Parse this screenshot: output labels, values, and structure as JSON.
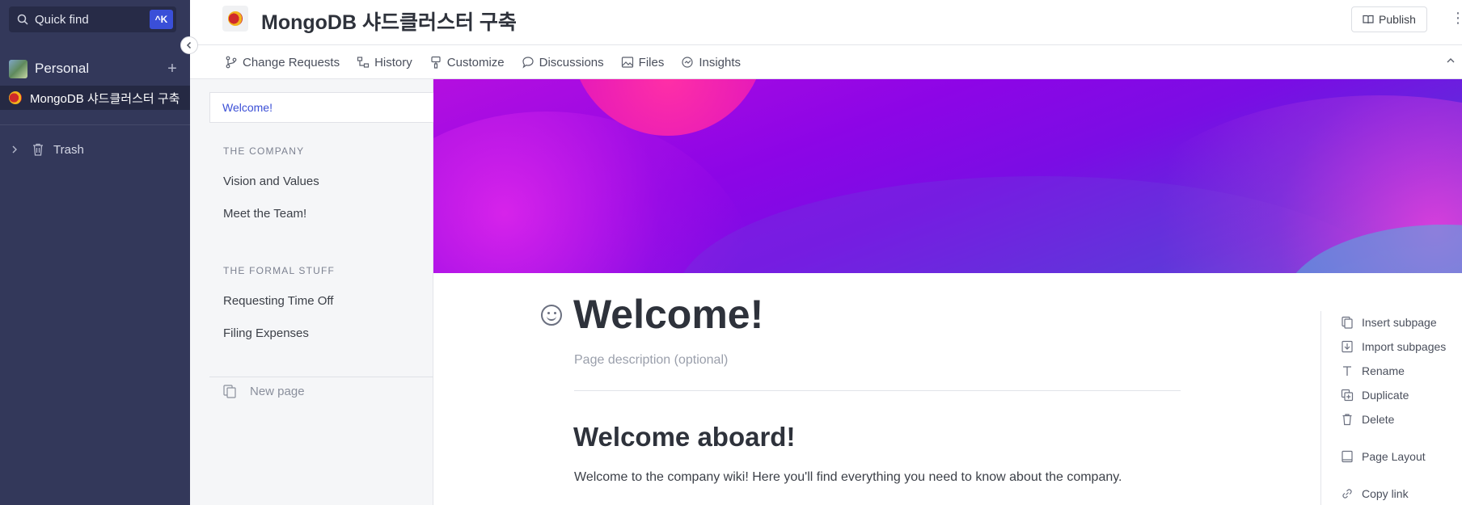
{
  "sidebar": {
    "quick_find": "Quick find",
    "shortcut": "^K",
    "space_name": "Personal",
    "active_page": "MongoDB 샤드클러스터 구축",
    "trash": "Trash"
  },
  "header": {
    "title": "MongoDB 샤드클러스터 구축",
    "publish": "Publish"
  },
  "tabs": [
    {
      "label": "Change Requests",
      "icon": "branch-icon"
    },
    {
      "label": "History",
      "icon": "history-icon"
    },
    {
      "label": "Customize",
      "icon": "paint-icon"
    },
    {
      "label": "Discussions",
      "icon": "chat-icon"
    },
    {
      "label": "Files",
      "icon": "image-icon"
    },
    {
      "label": "Insights",
      "icon": "insights-icon"
    }
  ],
  "tree": {
    "active": "Welcome!",
    "sections": [
      {
        "heading": "THE COMPANY",
        "items": [
          "Vision and Values",
          "Meet the Team!"
        ]
      },
      {
        "heading": "THE FORMAL STUFF",
        "items": [
          "Requesting Time Off",
          "Filing Expenses"
        ]
      }
    ],
    "new_page": "New page"
  },
  "document": {
    "title": "Welcome!",
    "description_placeholder": "Page description (optional)",
    "heading": "Welcome aboard!",
    "paragraph": "Welcome to the company wiki! Here you'll find everything you need to know about the company."
  },
  "actions": [
    {
      "label": "Insert subpage",
      "icon": "insert-subpage-icon"
    },
    {
      "label": "Import subpages",
      "icon": "import-icon"
    },
    {
      "label": "Rename",
      "icon": "text-icon"
    },
    {
      "label": "Duplicate",
      "icon": "duplicate-icon"
    },
    {
      "label": "Delete",
      "icon": "trash-icon"
    },
    {
      "label": "Page Layout",
      "icon": "layout-icon"
    },
    {
      "label": "Copy link",
      "icon": "link-icon"
    }
  ],
  "colors": {
    "sidebar_bg": "#33385a",
    "accent": "#3b4fd6",
    "banner_purple": "#8d05e6"
  }
}
